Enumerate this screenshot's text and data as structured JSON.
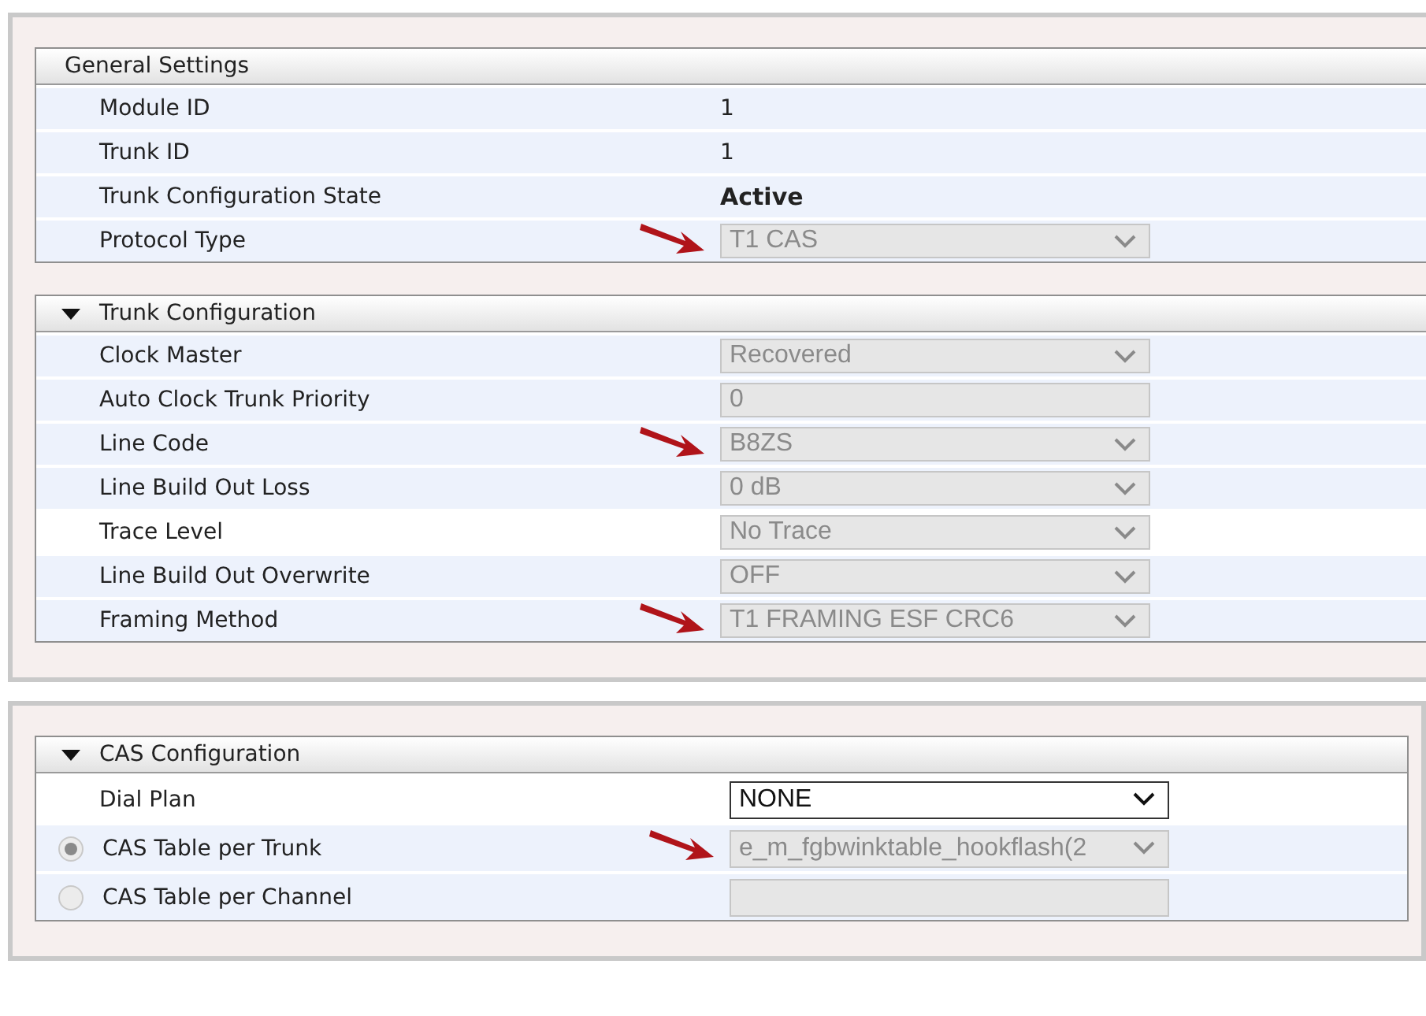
{
  "panels": [
    {
      "sections": [
        {
          "title": "General Settings",
          "collapsible": false,
          "rows": [
            {
              "label": "Module ID",
              "kind": "plain",
              "shaded": true,
              "value": {
                "kind": "text",
                "text": "1"
              }
            },
            {
              "label": "Trunk ID",
              "kind": "plain",
              "shaded": true,
              "value": {
                "kind": "text",
                "text": "1"
              }
            },
            {
              "label": "Trunk Configuration State",
              "kind": "plain",
              "shaded": true,
              "value": {
                "kind": "strong",
                "text": "Active"
              }
            },
            {
              "label": "Protocol Type",
              "kind": "plain",
              "shaded": true,
              "value": {
                "kind": "select",
                "text": "T1 CAS",
                "disabled": true,
                "marked": true
              }
            }
          ]
        },
        {
          "title": "Trunk Configuration",
          "collapsible": true,
          "rows": [
            {
              "label": "Clock Master",
              "kind": "plain",
              "shaded": true,
              "value": {
                "kind": "select",
                "text": "Recovered",
                "disabled": true,
                "marked": false
              }
            },
            {
              "label": "Auto Clock Trunk Priority",
              "kind": "plain",
              "shaded": true,
              "value": {
                "kind": "input",
                "text": "0",
                "disabled": true,
                "marked": false
              }
            },
            {
              "label": "Line Code",
              "kind": "plain",
              "shaded": true,
              "value": {
                "kind": "select",
                "text": "B8ZS",
                "disabled": true,
                "marked": true
              }
            },
            {
              "label": "Line Build Out Loss",
              "kind": "plain",
              "shaded": true,
              "value": {
                "kind": "select",
                "text": "0 dB",
                "disabled": true,
                "marked": false
              }
            },
            {
              "label": "Trace Level",
              "kind": "plain",
              "shaded": false,
              "value": {
                "kind": "select",
                "text": "No Trace",
                "disabled": true,
                "marked": false
              }
            },
            {
              "label": "Line Build Out Overwrite",
              "kind": "plain",
              "shaded": true,
              "value": {
                "kind": "select",
                "text": "OFF",
                "disabled": true,
                "marked": false
              }
            },
            {
              "label": "Framing Method",
              "kind": "plain",
              "shaded": true,
              "value": {
                "kind": "select",
                "text": "T1 FRAMING ESF CRC6",
                "disabled": true,
                "marked": true
              }
            }
          ]
        }
      ]
    },
    {
      "sections": [
        {
          "title": "CAS Configuration",
          "collapsible": true,
          "rows": [
            {
              "label": "Dial Plan",
              "kind": "plain",
              "shaded": false,
              "value": {
                "kind": "select",
                "text": "NONE",
                "disabled": false,
                "marked": false
              }
            },
            {
              "label": "CAS Table per Trunk",
              "kind": "radio",
              "selected": true,
              "shaded": true,
              "value": {
                "kind": "select",
                "text": "e_m_fgbwinktable_hookflash(2",
                "disabled": true,
                "marked": true
              }
            },
            {
              "label": "CAS Table per Channel",
              "kind": "radio",
              "selected": false,
              "shaded": true,
              "value": {
                "kind": "input",
                "disabled": true,
                "marked": false
              }
            }
          ]
        }
      ]
    }
  ]
}
